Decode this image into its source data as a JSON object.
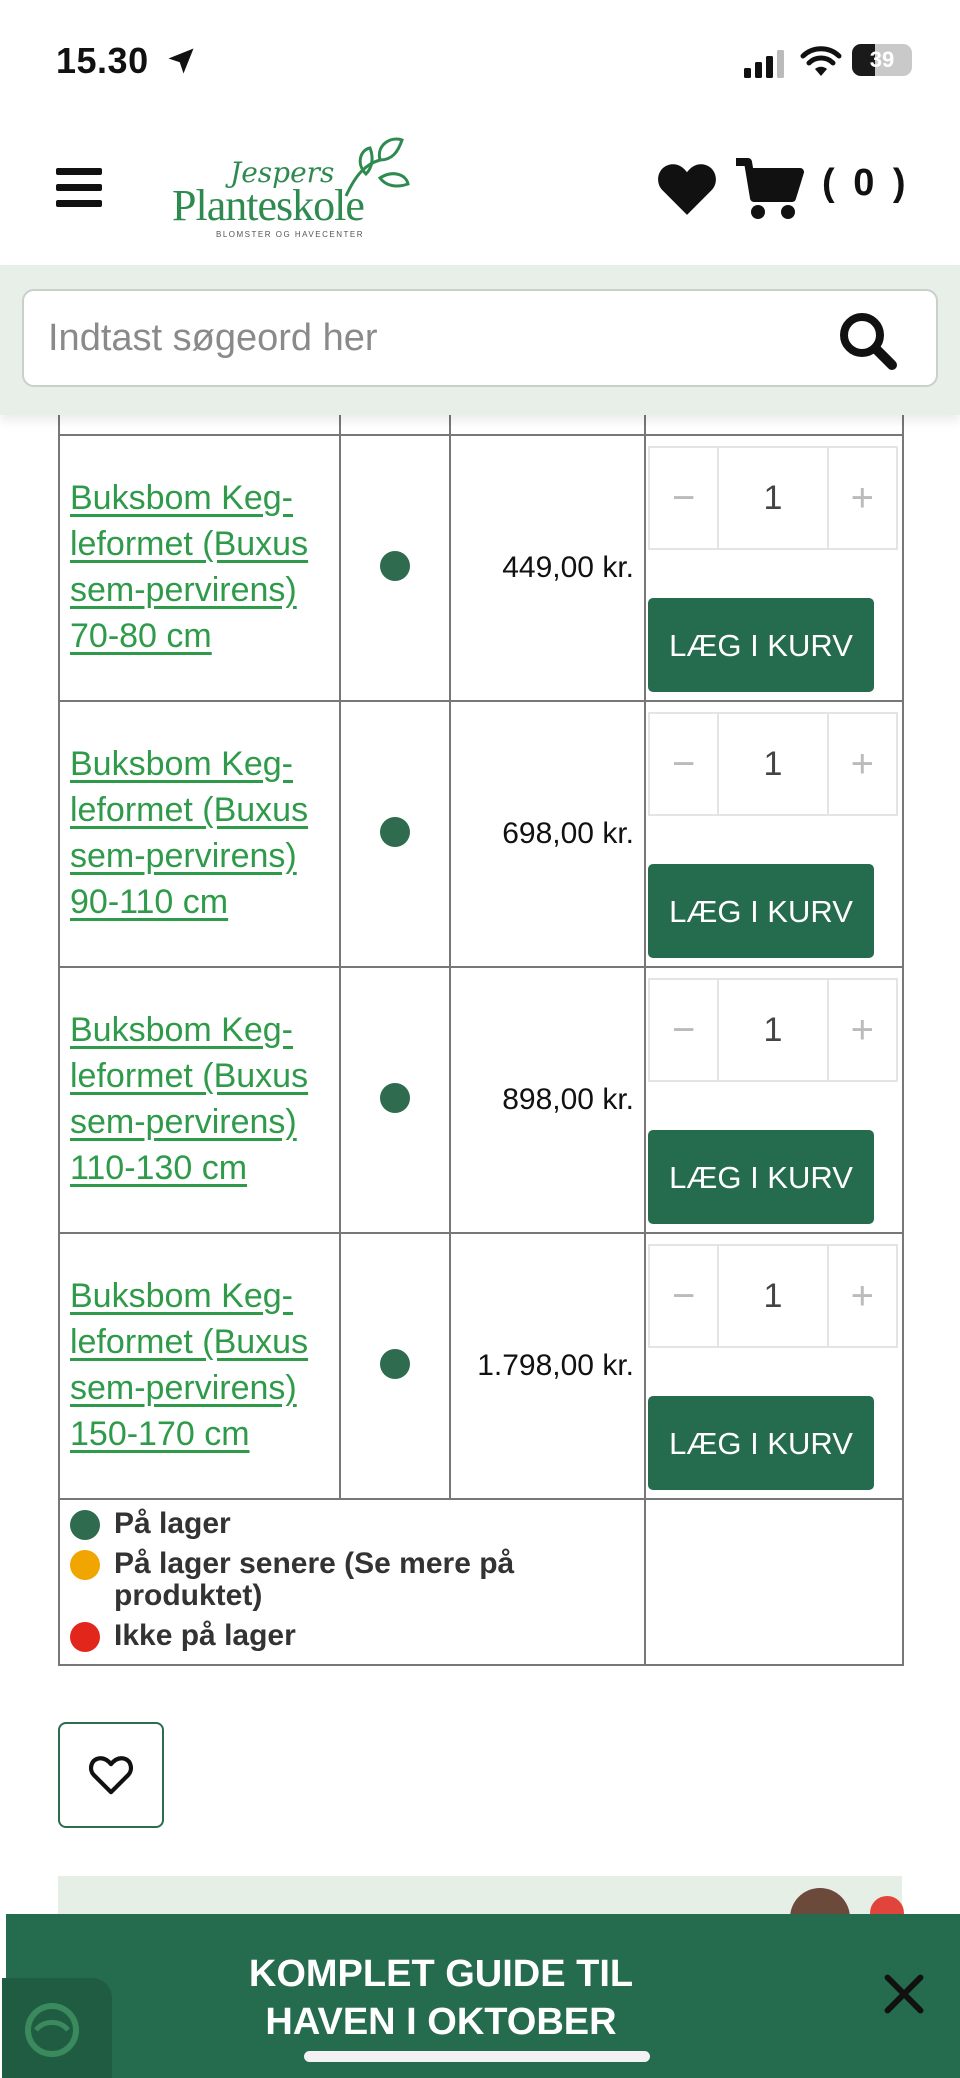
{
  "status_bar": {
    "time": "15.30",
    "battery": "39",
    "battery_level": 0.39
  },
  "header": {
    "logo_top": "Jespers",
    "logo_main": "Planteskole",
    "logo_sub": "BLOMSTER OG HAVECENTER",
    "cart_count": "( 0 )"
  },
  "search": {
    "placeholder": "Indtast søgeord her"
  },
  "products": [
    {
      "name": "Buksbom Keg-leformet (Buxus sem-pervirens) 70-80 cm",
      "price": "449,00 kr.",
      "qty": "1",
      "add_label": "LÆG I KURV",
      "stock": "in-stock"
    },
    {
      "name": "Buksbom Keg-leformet (Buxus sem-pervirens) 90-110 cm",
      "price": "698,00 kr.",
      "qty": "1",
      "add_label": "LÆG I KURV",
      "stock": "in-stock"
    },
    {
      "name": "Buksbom Keg-leformet (Buxus sem-pervirens) 110-130 cm",
      "price": "898,00 kr.",
      "qty": "1",
      "add_label": "LÆG I KURV",
      "stock": "in-stock"
    },
    {
      "name": "Buksbom Keg-leformet (Buxus sem-pervirens) 150-170 cm",
      "price": "1.798,00 kr.",
      "qty": "1",
      "add_label": "LÆG I KURV",
      "stock": "in-stock"
    }
  ],
  "qty_controls": {
    "minus": "−",
    "plus": "+"
  },
  "legend": [
    {
      "label": "På lager",
      "color": "#2f6b4f"
    },
    {
      "label": "På lager senere (Se mere på produktet)",
      "color": "#f0a500"
    },
    {
      "label": "Ikke på lager",
      "color": "#e3261c"
    }
  ],
  "banner": {
    "line1": "KOMPLET GUIDE TIL",
    "line2": "HAVEN I OKTOBER"
  },
  "colors": {
    "brand_green": "#256b4d",
    "link_green": "#2f9a4a",
    "search_bg": "#e8efe8"
  }
}
